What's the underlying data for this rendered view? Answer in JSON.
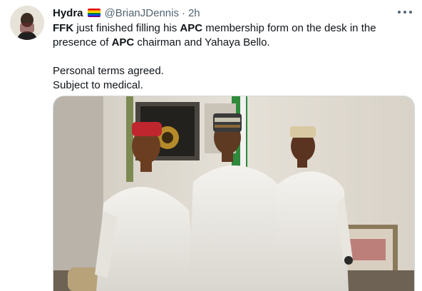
{
  "tweet": {
    "author_name": "Hydra",
    "author_handle": "@BrianJDennis",
    "separator": "·",
    "time": "2h",
    "text": {
      "p1_a": "FFK",
      "p1_b": " just finished filling his ",
      "p1_c": "APC",
      "p1_d": " membership form on the desk in the presence of ",
      "p1_e": "APC",
      "p1_f": " chairman and Yahaya Bello.",
      "p2": "Personal terms agreed.",
      "p3": "Subject to medical."
    }
  },
  "colors": {
    "text_primary": "#0f1419",
    "text_secondary": "#536471",
    "border": "#cfd9de"
  },
  "icons": [
    "rainbow-flag-icon",
    "more-options-icon"
  ]
}
